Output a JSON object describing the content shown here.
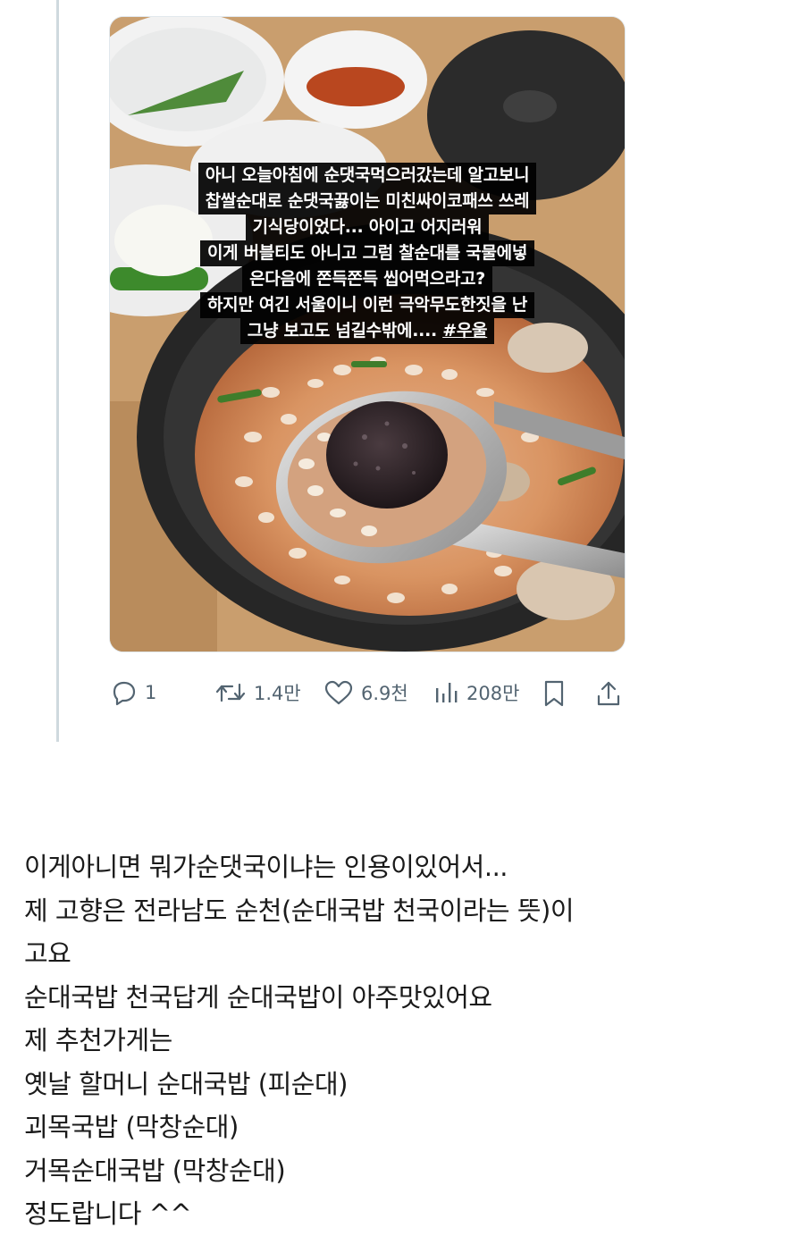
{
  "tweet": {
    "image_caption_lines": [
      "아니 오늘아침에 순댓국먹으러갔는데 알고보니",
      "찹쌀순대로 순댓국끓이는 미친싸이코패쓰 쓰레",
      "기식당이었다... 아이고 어지러워",
      "이게 버블티도 아니고 그럼 찰순대를 국물에넣",
      "은다음에 쫀득쫀득 씹어먹으라고?",
      "하지만 여긴 서울이니 이런 극악무도한짓을 난"
    ],
    "image_caption_last_prefix": "그냥 보고도 넘길수밖에.... ",
    "image_caption_hashtag": "#우울",
    "actions": {
      "reply_count": "1",
      "retweet_count": "1.4만",
      "like_count": "6.9천",
      "view_count": "208만"
    },
    "colors": {
      "action_gray": "#536471",
      "thread_line": "#cfd9de"
    }
  },
  "post_lines": [
    "이게아니면 뭐가순댓국이냐는 인용이있어서...",
    "제 고향은 전라남도 순천(순대국밥 천국이라는 뜻)이",
    "고요",
    "순대국밥 천국답게 순대국밥이 아주맛있어요",
    "제 추천가게는",
    "옛날 할머니 순대국밥 (피순대)",
    "괴목국밥 (막창순대)",
    "거목순대국밥 (막창순대)",
    "정도랍니다 ^^"
  ]
}
